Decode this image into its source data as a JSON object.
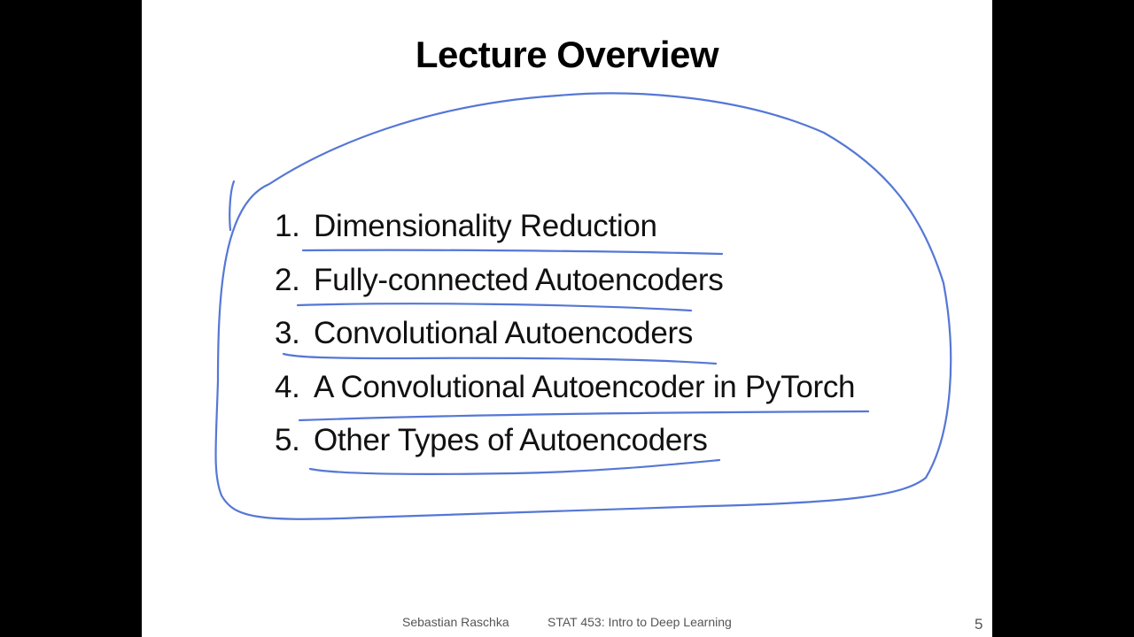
{
  "slide": {
    "title": "Lecture Overview",
    "items": [
      {
        "number": "1.",
        "text": "Dimensionality Reduction"
      },
      {
        "number": "2.",
        "text": "Fully-connected Autoencoders"
      },
      {
        "number": "3.",
        "text": "Convolutional Autoencoders"
      },
      {
        "number": "4.",
        "text": "A Convolutional Autoencoder in PyTorch"
      },
      {
        "number": "5.",
        "text": "Other Types of Autoencoders"
      }
    ],
    "footer": {
      "author": "Sebastian Raschka",
      "course": "STAT 453: Intro to Deep Learning",
      "page": "5"
    }
  },
  "annotation_color": "#5577d6"
}
